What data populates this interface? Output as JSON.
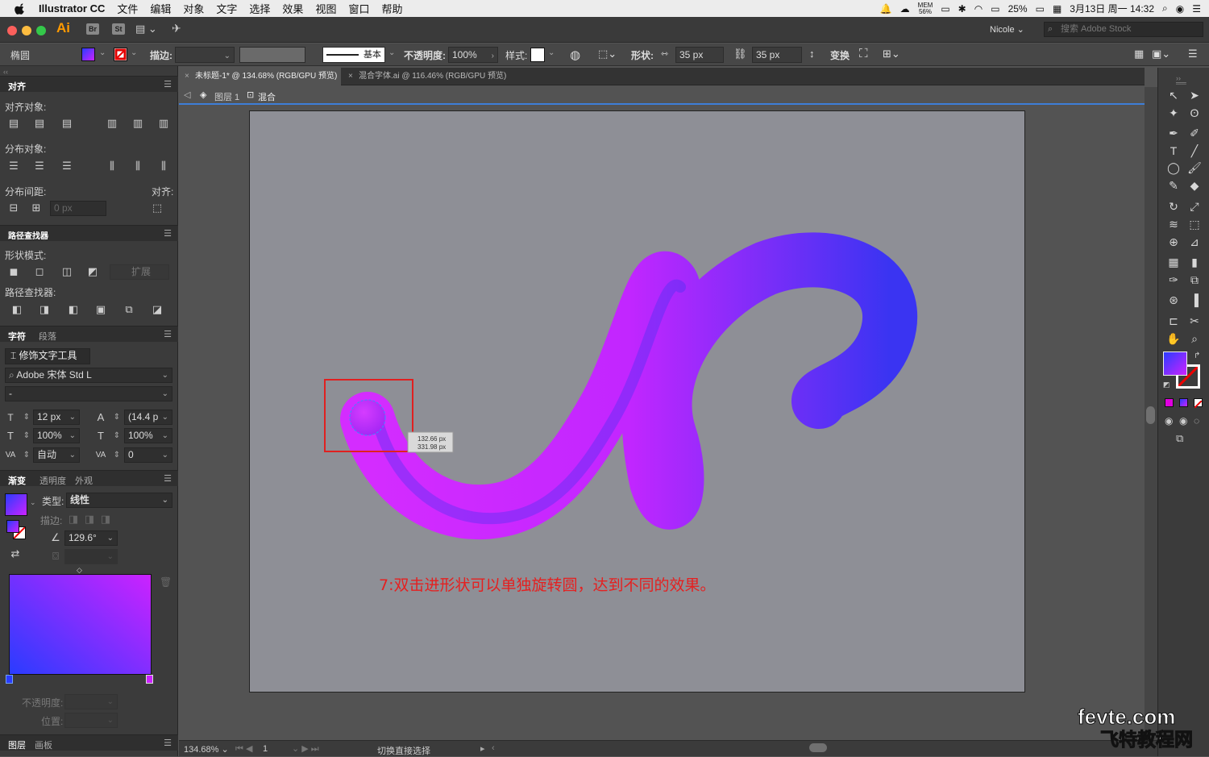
{
  "menubar": {
    "app": "Illustrator CC",
    "items": [
      "文件",
      "编辑",
      "对象",
      "文字",
      "选择",
      "效果",
      "视图",
      "窗口",
      "帮助"
    ],
    "right": {
      "mem": "MEM",
      "mem_pct": "56%",
      "battery": "25%",
      "datetime": "3月13日 周一 14:32"
    }
  },
  "titlebar": {
    "logo": "Ai",
    "br": "Br",
    "st": "St",
    "user": "Nicole",
    "stock_placeholder": "搜索 Adobe Stock"
  },
  "control": {
    "object": "椭圆",
    "stroke_label": "描边:",
    "stroke_style": "基本",
    "opacity_label": "不透明度:",
    "opacity": "100%",
    "style_label": "样式:",
    "shape_label": "形状:",
    "width": "35 px",
    "height": "35 px",
    "transform": "变换"
  },
  "tabs": [
    {
      "label": "未标题-1* @ 134.68% (RGB/GPU 预览)",
      "active": true
    },
    {
      "label": "混合字体.ai @ 116.46% (RGB/GPU 预览)",
      "active": false
    }
  ],
  "crumbs": {
    "layer": "图层 1",
    "group": "混合"
  },
  "align_panel": {
    "title": "对齐",
    "align_objects": "对齐对象:",
    "distribute_objects": "分布对象:",
    "distribute_spacing": "分布间距:",
    "align_to": "对齐:",
    "spacing_value": "0 px"
  },
  "pathfinder": {
    "title": "路径查找器",
    "shape_modes": "形状模式:",
    "expand": "扩展",
    "pathfinders": "路径查找器:"
  },
  "character": {
    "tab1": "字符",
    "tab2": "段落",
    "touch_tool": "修饰文字工具",
    "font": "Adobe 宋体 Std L",
    "style": "-",
    "size": "12 px",
    "leading": "(14.4 p",
    "vscale": "100%",
    "hscale": "100%",
    "kerning": "自动",
    "tracking": "0"
  },
  "gradient": {
    "tab1": "渐变",
    "tab2": "透明度",
    "tab3": "外观",
    "type_label": "类型:",
    "type": "线性",
    "stroke_label": "描边:",
    "angle": "129.6°",
    "opacity_label": "不透明度:",
    "position_label": "位置:",
    "colors": {
      "start": "#2a3cff",
      "end": "#cc22ff"
    }
  },
  "bottom_tabs": {
    "tab1": "图层",
    "tab2": "画板"
  },
  "canvas": {
    "annotation": "7:双击进形状可以单独旋转圆，达到不同的效果。",
    "tooltip_w": "132.66 px",
    "tooltip_h": "331.98 px"
  },
  "status": {
    "zoom": "134.68%",
    "page": "1",
    "tool": "切换直接选择"
  },
  "watermark": {
    "line1": "fevte.com",
    "line2": "飞特教程网"
  }
}
